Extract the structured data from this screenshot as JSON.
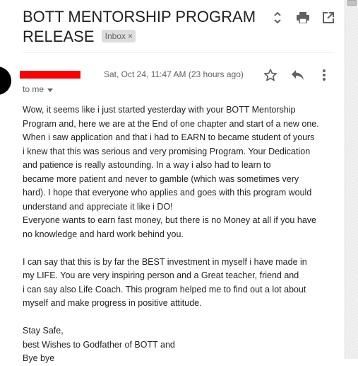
{
  "email": {
    "subject_line1": "BOTT MENTORSHIP PROGRAM",
    "subject_line2": "RELEASE",
    "label_badge": "Inbox",
    "badge_close": "×",
    "date": "Sat, Oct 24, 11:47 AM (23 hours ago)",
    "recipient": "to me",
    "body": [
      "Wow, it seems like i just started yesterday with your BOTT Mentorship",
      "Program and, here we are at the End of one chapter and start of a new one.",
      "When i saw application and that i had to EARN to became student of  yours",
      "i knew that this was serious and very promising Program. Your Dedication",
      "and patience is really astounding. In a way i also had to learn to",
      "became more patient and never to gamble (which was sometimes very",
      "hard). I hope that everyone who applies and goes with this program would",
      "understand and appreciate it like i DO!",
      "Everyone wants to earn fast money, but there is no Money at all if you have",
      "no knowledge and hard work behind you.",
      "",
      "I can say that this is by far the BEST investment in myself i have made in",
      "my LIFE. You are very inspiring person and a Great teacher, friend and",
      "i can say also Life Coach. This program helped me to find out a lot about",
      "myself and make progress in positive attitude.",
      "",
      "Stay Safe,",
      "best Wishes to Godfather of BOTT and",
      "Bye bye"
    ]
  },
  "icons": {
    "expand": "unfold-icon",
    "print": "print-icon",
    "open_new_window": "open-in-new-icon",
    "star": "star-icon",
    "reply": "reply-icon",
    "more": "more-vert-icon",
    "dropdown": "chevron-down-icon"
  },
  "colors": {
    "redaction": "#ff0000",
    "icon": "#5f6368",
    "badge_bg": "#dddddd"
  }
}
